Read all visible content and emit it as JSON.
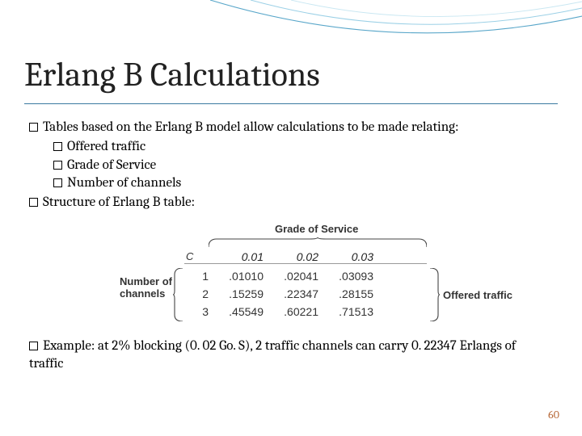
{
  "title": "Erlang B Calculations",
  "bullets": {
    "b1": "Tables based on the Erlang B model allow calculations to be made relating:",
    "b1a": "Offered traffic",
    "b1b": "Grade of Service",
    "b1c": "Number of channels",
    "b2": "Structure of Erlang B table:",
    "b3": "Example: at 2% blocking (0. 02 Go. S), 2 traffic channels can carry 0. 22347 Erlangs of traffic"
  },
  "chart_data": {
    "type": "table",
    "top_label": "Grade of Service",
    "left_label": "Number of channels",
    "right_label": "Offered traffic",
    "col_marker": "C",
    "columns": [
      "0.01",
      "0.02",
      "0.03"
    ],
    "rows": [
      {
        "n": "1",
        "cells": [
          ".01010",
          ".02041",
          ".03093"
        ]
      },
      {
        "n": "2",
        "cells": [
          ".15259",
          ".22347",
          ".28155"
        ]
      },
      {
        "n": "3",
        "cells": [
          ".45549",
          ".60221",
          ".71513"
        ]
      }
    ]
  },
  "page_number": "60"
}
